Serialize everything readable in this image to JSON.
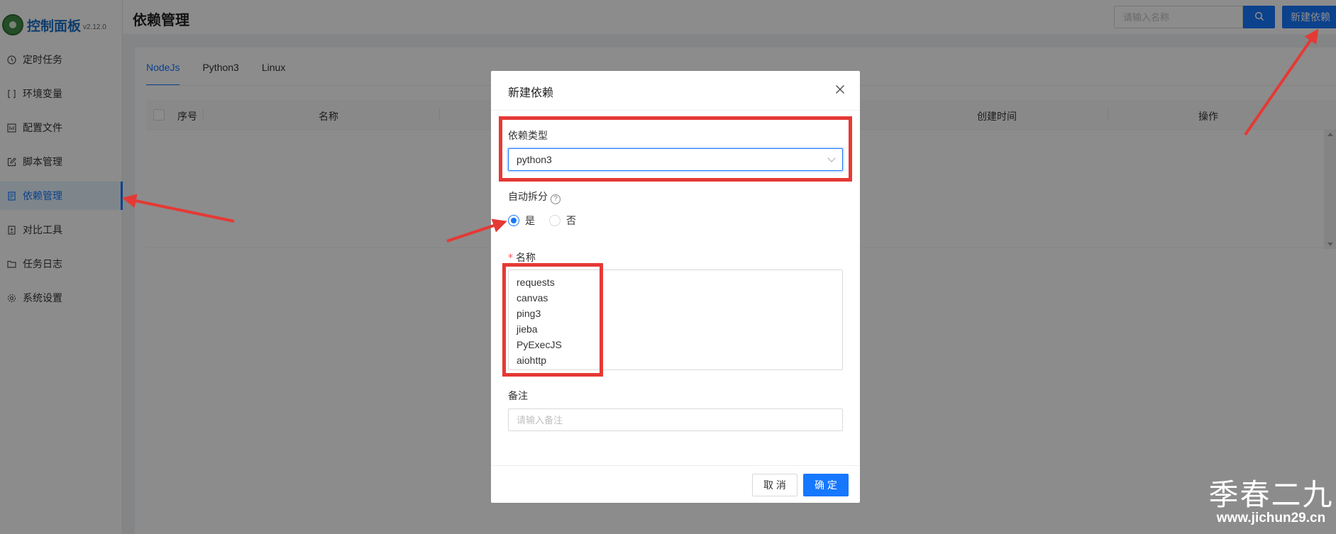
{
  "app": {
    "logo_title": "控制面板",
    "version": "v2.12.0"
  },
  "sidebar": {
    "items": [
      {
        "label": "定时任务",
        "icon": "clock-icon"
      },
      {
        "label": "环境变量",
        "icon": "variable-icon"
      },
      {
        "label": "配置文件",
        "icon": "config-file-icon"
      },
      {
        "label": "脚本管理",
        "icon": "edit-icon"
      },
      {
        "label": "依赖管理",
        "icon": "dependency-icon",
        "active": true
      },
      {
        "label": "对比工具",
        "icon": "diff-icon"
      },
      {
        "label": "任务日志",
        "icon": "folder-icon"
      },
      {
        "label": "系统设置",
        "icon": "gear-icon"
      }
    ]
  },
  "header": {
    "title": "依赖管理",
    "search_placeholder": "请输入名称",
    "new_button": "新建依赖"
  },
  "tabs": [
    {
      "label": "NodeJs",
      "active": true
    },
    {
      "label": "Python3"
    },
    {
      "label": "Linux"
    }
  ],
  "table": {
    "columns": [
      "序号",
      "名称",
      "创建时间",
      "操作"
    ]
  },
  "modal": {
    "title": "新建依赖",
    "type_label": "依赖类型",
    "type_value": "python3",
    "auto_split_label": "自动拆分",
    "auto_split_options": [
      "是",
      "否"
    ],
    "auto_split_selected": "是",
    "name_label": "名称",
    "name_value": "requests\ncanvas\nping3\njieba\nPyExecJS\naiohttp",
    "note_label": "备注",
    "note_placeholder": "请输入备注",
    "cancel_label": "取 消",
    "ok_label": "确 定"
  },
  "watermark": {
    "text": "季春二九",
    "url": "www.jichun29.cn"
  },
  "colors": {
    "primary": "#1677ff",
    "annotation": "#e53935",
    "mask": "rgba(0,0,0,0.45)"
  }
}
